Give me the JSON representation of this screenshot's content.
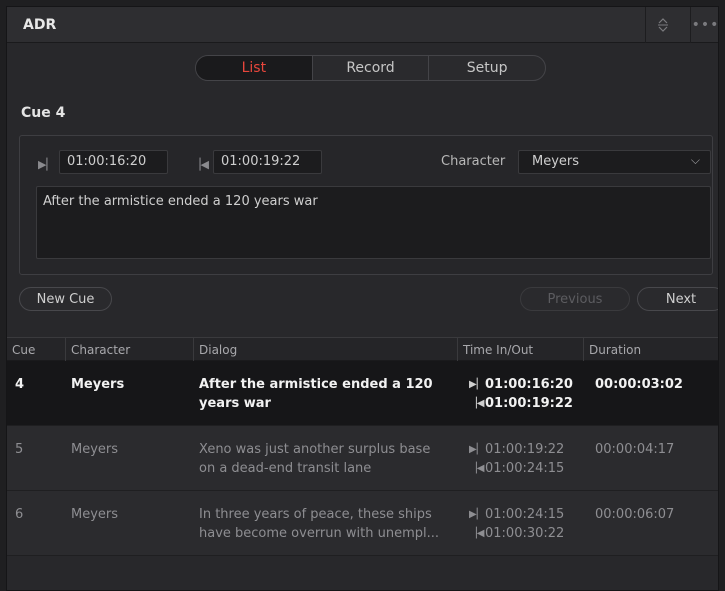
{
  "header": {
    "title": "ADR"
  },
  "tabs": [
    {
      "label": "List",
      "active": true
    },
    {
      "label": "Record",
      "active": false
    },
    {
      "label": "Setup",
      "active": false
    }
  ],
  "cue_editor": {
    "title": "Cue 4",
    "time_in": "01:00:16:20",
    "time_out": "01:00:19:22",
    "character_label": "Character",
    "character_value": "Meyers",
    "dialog": "After the armistice ended a 120 years war"
  },
  "buttons": {
    "new_cue": "New Cue",
    "previous": "Previous",
    "next": "Next"
  },
  "table": {
    "columns": [
      "Cue",
      "Character",
      "Dialog",
      "Time In/Out",
      "Duration"
    ],
    "rows": [
      {
        "cue": "4",
        "character": "Meyers",
        "dialog_1": "After the armistice ended a 120",
        "dialog_2": "years war",
        "time_in": "01:00:16:20",
        "time_out": "01:00:19:22",
        "duration": "00:00:03:02"
      },
      {
        "cue": "5",
        "character": "Meyers",
        "dialog_1": "Xeno was just another surplus base",
        "dialog_2": "on a dead-end transit lane",
        "time_in": "01:00:19:22",
        "time_out": "01:00:24:15",
        "duration": "00:00:04:17"
      },
      {
        "cue": "6",
        "character": "Meyers",
        "dialog_1": "In three years of peace, these ships",
        "dialog_2": "have become overrun with unempl...",
        "time_in": "01:00:24:15",
        "time_out": "01:00:30:22",
        "duration": "00:00:06:07"
      }
    ]
  },
  "colors": {
    "accent": "#e8463c",
    "panel": "#28282b",
    "selected_row": "#161618"
  },
  "icons": {
    "sort": "sort-icon",
    "more": "more-options-icon",
    "mark_in": "mark-in-icon",
    "mark_out": "mark-out-icon",
    "dropdown": "chevron-down-icon"
  }
}
